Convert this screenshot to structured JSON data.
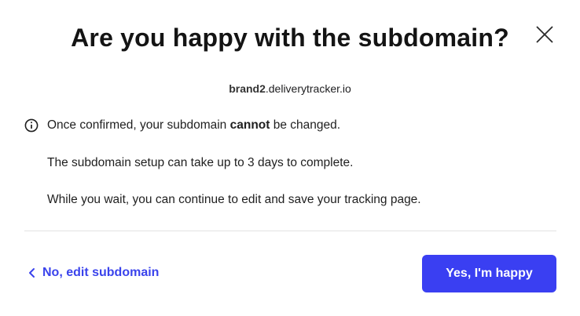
{
  "dialog": {
    "title": "Are you happy with the subdomain?",
    "subdomain": {
      "prefix": "brand2",
      "suffix": ".deliverytracker.io"
    },
    "notes": {
      "line1_before": "Once confirmed, your subdomain ",
      "line1_bold": "cannot",
      "line1_after": " be changed.",
      "line2": "The subdomain setup can take up to 3 days to complete.",
      "line3": "While you wait, you can continue to edit and save your tracking page."
    },
    "back_label": "No, edit subdomain",
    "confirm_label": "Yes, I'm happy",
    "icons": {
      "close": "close-icon",
      "info": "info-icon",
      "back": "chevron-left-icon"
    }
  },
  "colors": {
    "accent": "#3a3ff2",
    "link": "#3a43ec",
    "text": "#1f1f1f",
    "divider": "#e2e2e2"
  }
}
